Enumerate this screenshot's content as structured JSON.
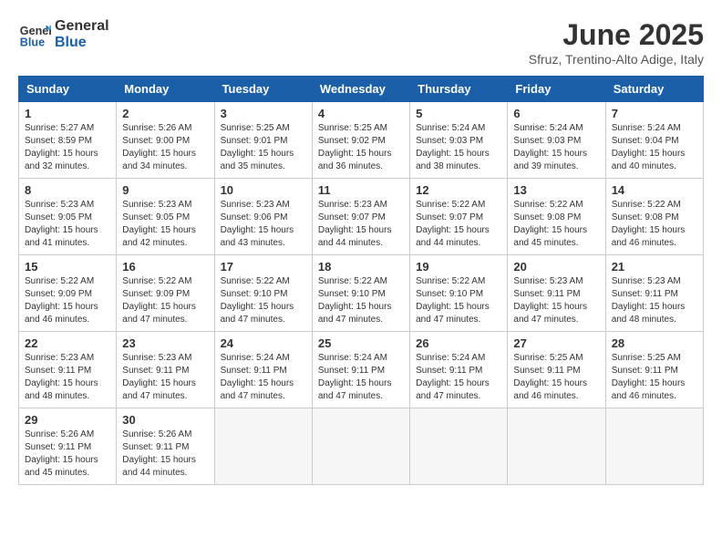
{
  "app": {
    "logo_line1": "General",
    "logo_line2": "Blue"
  },
  "header": {
    "title": "June 2025",
    "subtitle": "Sfruz, Trentino-Alto Adige, Italy"
  },
  "columns": [
    "Sunday",
    "Monday",
    "Tuesday",
    "Wednesday",
    "Thursday",
    "Friday",
    "Saturday"
  ],
  "weeks": [
    [
      {
        "day": "1",
        "sunrise": "5:27 AM",
        "sunset": "8:59 PM",
        "daylight": "15 hours and 32 minutes."
      },
      {
        "day": "2",
        "sunrise": "5:26 AM",
        "sunset": "9:00 PM",
        "daylight": "15 hours and 34 minutes."
      },
      {
        "day": "3",
        "sunrise": "5:25 AM",
        "sunset": "9:01 PM",
        "daylight": "15 hours and 35 minutes."
      },
      {
        "day": "4",
        "sunrise": "5:25 AM",
        "sunset": "9:02 PM",
        "daylight": "15 hours and 36 minutes."
      },
      {
        "day": "5",
        "sunrise": "5:24 AM",
        "sunset": "9:03 PM",
        "daylight": "15 hours and 38 minutes."
      },
      {
        "day": "6",
        "sunrise": "5:24 AM",
        "sunset": "9:03 PM",
        "daylight": "15 hours and 39 minutes."
      },
      {
        "day": "7",
        "sunrise": "5:24 AM",
        "sunset": "9:04 PM",
        "daylight": "15 hours and 40 minutes."
      }
    ],
    [
      {
        "day": "8",
        "sunrise": "5:23 AM",
        "sunset": "9:05 PM",
        "daylight": "15 hours and 41 minutes."
      },
      {
        "day": "9",
        "sunrise": "5:23 AM",
        "sunset": "9:05 PM",
        "daylight": "15 hours and 42 minutes."
      },
      {
        "day": "10",
        "sunrise": "5:23 AM",
        "sunset": "9:06 PM",
        "daylight": "15 hours and 43 minutes."
      },
      {
        "day": "11",
        "sunrise": "5:23 AM",
        "sunset": "9:07 PM",
        "daylight": "15 hours and 44 minutes."
      },
      {
        "day": "12",
        "sunrise": "5:22 AM",
        "sunset": "9:07 PM",
        "daylight": "15 hours and 44 minutes."
      },
      {
        "day": "13",
        "sunrise": "5:22 AM",
        "sunset": "9:08 PM",
        "daylight": "15 hours and 45 minutes."
      },
      {
        "day": "14",
        "sunrise": "5:22 AM",
        "sunset": "9:08 PM",
        "daylight": "15 hours and 46 minutes."
      }
    ],
    [
      {
        "day": "15",
        "sunrise": "5:22 AM",
        "sunset": "9:09 PM",
        "daylight": "15 hours and 46 minutes."
      },
      {
        "day": "16",
        "sunrise": "5:22 AM",
        "sunset": "9:09 PM",
        "daylight": "15 hours and 47 minutes."
      },
      {
        "day": "17",
        "sunrise": "5:22 AM",
        "sunset": "9:10 PM",
        "daylight": "15 hours and 47 minutes."
      },
      {
        "day": "18",
        "sunrise": "5:22 AM",
        "sunset": "9:10 PM",
        "daylight": "15 hours and 47 minutes."
      },
      {
        "day": "19",
        "sunrise": "5:22 AM",
        "sunset": "9:10 PM",
        "daylight": "15 hours and 47 minutes."
      },
      {
        "day": "20",
        "sunrise": "5:23 AM",
        "sunset": "9:11 PM",
        "daylight": "15 hours and 47 minutes."
      },
      {
        "day": "21",
        "sunrise": "5:23 AM",
        "sunset": "9:11 PM",
        "daylight": "15 hours and 48 minutes."
      }
    ],
    [
      {
        "day": "22",
        "sunrise": "5:23 AM",
        "sunset": "9:11 PM",
        "daylight": "15 hours and 48 minutes."
      },
      {
        "day": "23",
        "sunrise": "5:23 AM",
        "sunset": "9:11 PM",
        "daylight": "15 hours and 47 minutes."
      },
      {
        "day": "24",
        "sunrise": "5:24 AM",
        "sunset": "9:11 PM",
        "daylight": "15 hours and 47 minutes."
      },
      {
        "day": "25",
        "sunrise": "5:24 AM",
        "sunset": "9:11 PM",
        "daylight": "15 hours and 47 minutes."
      },
      {
        "day": "26",
        "sunrise": "5:24 AM",
        "sunset": "9:11 PM",
        "daylight": "15 hours and 47 minutes."
      },
      {
        "day": "27",
        "sunrise": "5:25 AM",
        "sunset": "9:11 PM",
        "daylight": "15 hours and 46 minutes."
      },
      {
        "day": "28",
        "sunrise": "5:25 AM",
        "sunset": "9:11 PM",
        "daylight": "15 hours and 46 minutes."
      }
    ],
    [
      {
        "day": "29",
        "sunrise": "5:26 AM",
        "sunset": "9:11 PM",
        "daylight": "15 hours and 45 minutes."
      },
      {
        "day": "30",
        "sunrise": "5:26 AM",
        "sunset": "9:11 PM",
        "daylight": "15 hours and 44 minutes."
      },
      null,
      null,
      null,
      null,
      null
    ]
  ]
}
